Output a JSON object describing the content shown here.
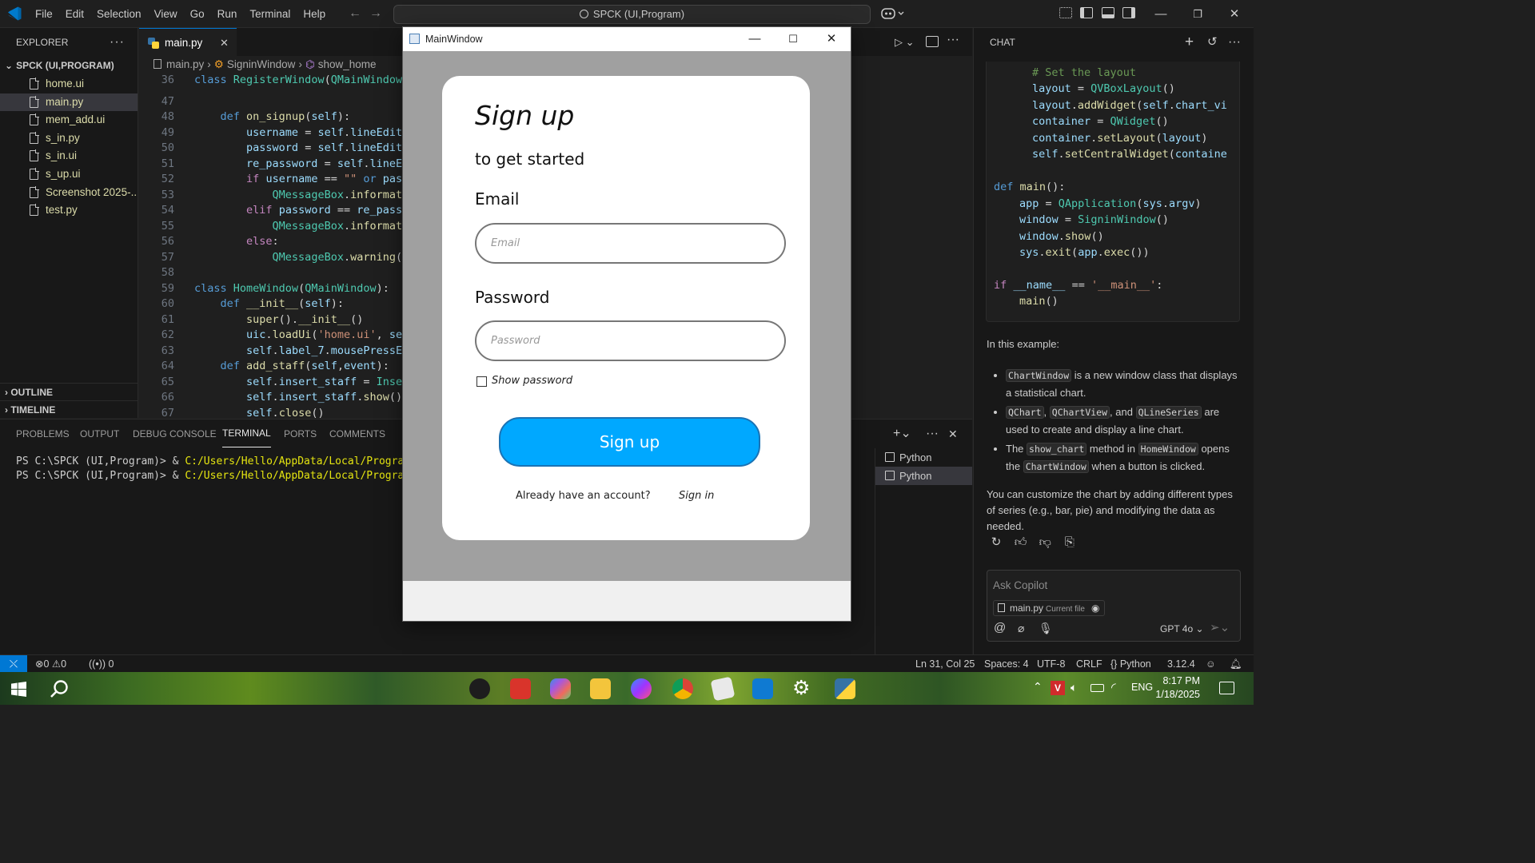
{
  "titlebar": {
    "menu": [
      "File",
      "Edit",
      "Selection",
      "View",
      "Go",
      "Run",
      "Terminal",
      "Help"
    ],
    "command_center": "SPCK (UI,Program)"
  },
  "explorer": {
    "header": "EXPLORER",
    "project": "SPCK (UI,PROGRAM)",
    "files": [
      "home.ui",
      "main.py",
      "mem_add.ui",
      "s_in.py",
      "s_in.ui",
      "s_up.ui",
      "Screenshot 2025-...",
      "test.py"
    ],
    "selected": "main.py",
    "outline": "OUTLINE",
    "timeline": "TIMELINE"
  },
  "editor": {
    "tab": "main.py",
    "breadcrumb": [
      "main.py",
      "SigninWindow",
      "show_home"
    ],
    "line_numbers": [
      "36",
      "47",
      "48",
      "49",
      "50",
      "51",
      "52",
      "53",
      "54",
      "55",
      "56",
      "57",
      "58",
      "59",
      "60",
      "61",
      "62",
      "63",
      "64",
      "65",
      "66",
      "67"
    ]
  },
  "panel": {
    "tabs": [
      "PROBLEMS",
      "OUTPUT",
      "DEBUG CONSOLE",
      "TERMINAL",
      "PORTS",
      "COMMENTS"
    ],
    "active_tab": "TERMINAL",
    "terminal_lines": [
      {
        "prompt": "PS C:\\SPCK (UI,Program)> & ",
        "path": "C:/Users/Hello/AppData/Local/Programs/P"
      },
      {
        "prompt": "PS C:\\SPCK (UI,Program)> & ",
        "path": "C:/Users/Hello/AppData/Local/Programs/P"
      }
    ],
    "terminals": [
      "Python",
      "Python"
    ]
  },
  "chat": {
    "header": "CHAT",
    "intro": "In this example:",
    "bullets": [
      {
        "code": "ChartWindow",
        "text": " is a new window class that displays a statistical chart."
      },
      {
        "code1": "QChart",
        "code2": "QChartView",
        "code3": "QLineSeries",
        "text": " are used to create and display a line chart."
      },
      {
        "pre": "The ",
        "code1": "show_chart",
        "mid": " method in ",
        "code2": "HomeWindow",
        "mid2": " opens the ",
        "code3": "ChartWindow",
        "text": " when a button is clicked."
      }
    ],
    "outro": "You can customize the chart by adding different types of series (e.g., bar, pie) and modifying the data as needed.",
    "ask_placeholder": "Ask Copilot",
    "context_file": "main.py",
    "context_label": "Current file",
    "model": "GPT 4o"
  },
  "statusbar": {
    "errors": "0",
    "warnings": "0",
    "ports": "0",
    "position": "Ln 31, Col 25",
    "spaces": "Spaces: 4",
    "encoding": "UTF-8",
    "eol": "CRLF",
    "language": "Python",
    "version": "3.12.4"
  },
  "taskbar": {
    "language": "ENG",
    "time": "8:17 PM",
    "date": "1/18/2025"
  },
  "mainwindow": {
    "title": "MainWindow",
    "heading": "Sign up",
    "subheading": "to get started",
    "email_label": "Email",
    "email_placeholder": "Email",
    "password_label": "Password",
    "password_placeholder": "Password",
    "show_password": "Show password",
    "signup_button": "Sign up",
    "have_account": "Already have an account?",
    "signin_link": "Sign in",
    "button_color": "#00a8ff"
  }
}
